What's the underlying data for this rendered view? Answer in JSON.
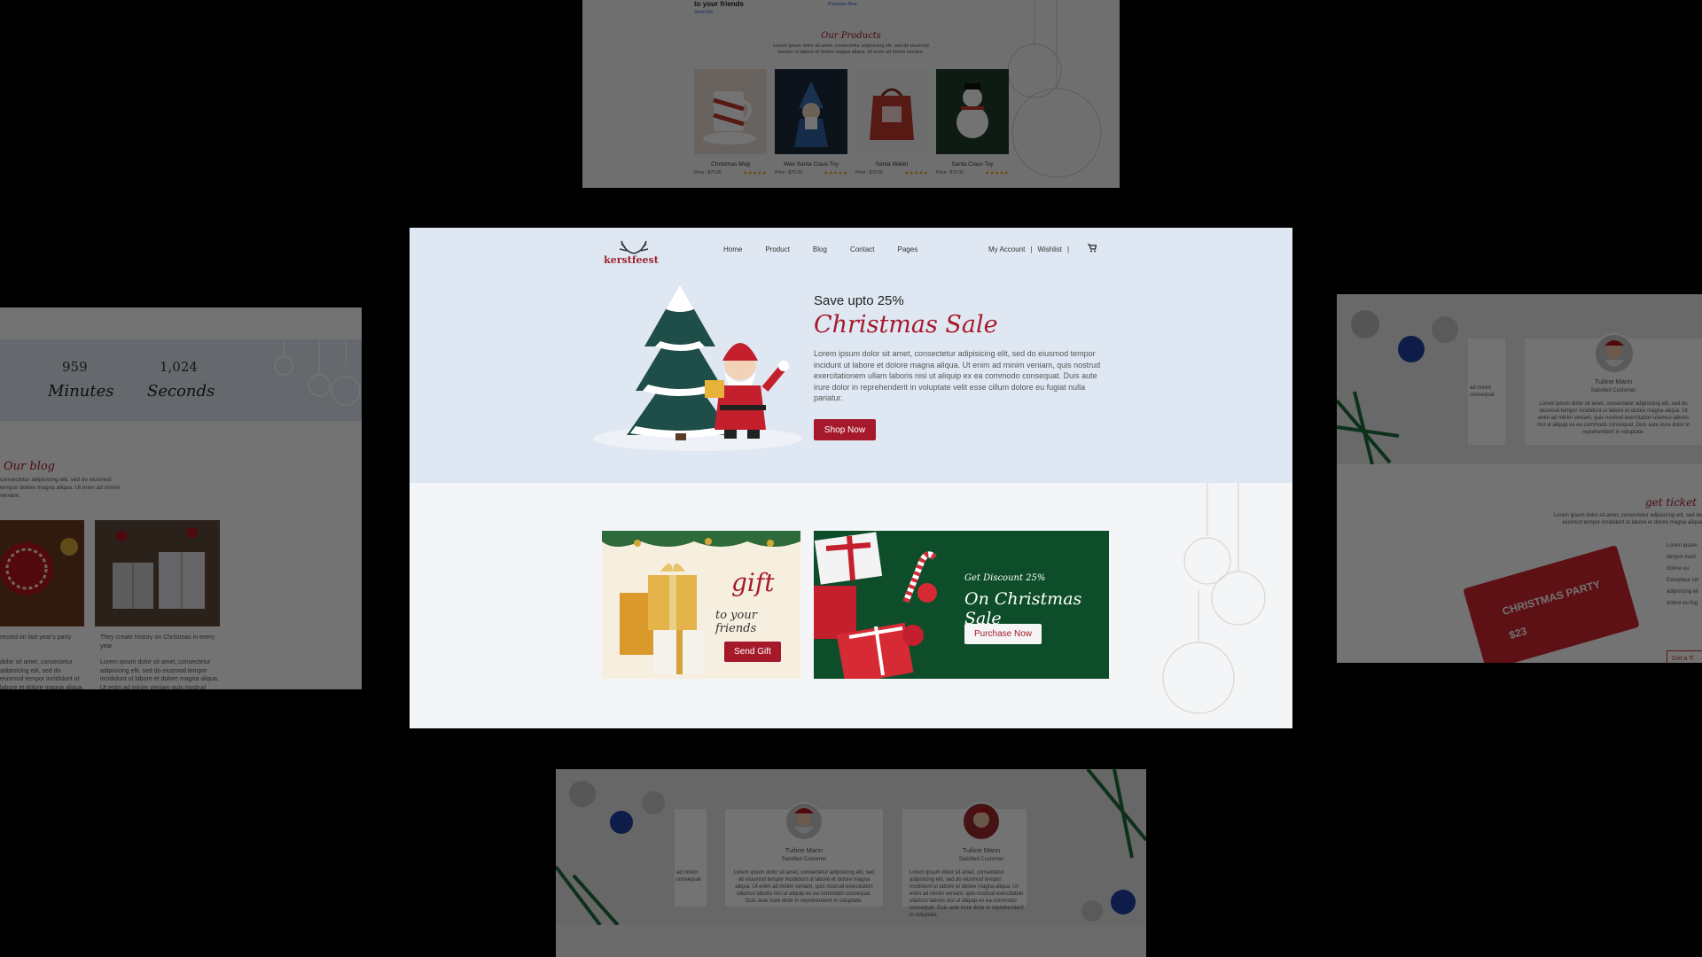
{
  "brand": {
    "name": "kerstfeest",
    "accent": "#a5192b"
  },
  "nav": {
    "links": [
      "Home",
      "Product",
      "Blog",
      "Contact",
      "Pages"
    ],
    "account": "My Account",
    "sep1": "|",
    "wishlist": "Wishlist",
    "sep2": "|",
    "cart_icon": "cart-icon"
  },
  "hero": {
    "kicker": "Save upto 25%",
    "title": "Christmas Sale",
    "body": "Lorem ipsum dolor sit amet, consectetur adipisicing elit, sed do eiusmod tempor incidunt ut labore et dolore magna aliqua. Ut enim ad minim veniam, quis nostrud exercitationem ullam laboris nisi ut aliquip ex ea commodo consequat. Duis aute irure dolor in reprehenderit in voluptate velit esse cillum dolore eu fugiat nulla pariatur.",
    "button": "Shop Now"
  },
  "promo_gift": {
    "title": "gift",
    "subtitle": "to your friends",
    "button": "Send Gift"
  },
  "promo_discount": {
    "kicker": "Get Discount 25%",
    "title": "On Christmas Sale",
    "button": "Purchase Now"
  },
  "top_preview": {
    "fragment": "to your friends",
    "send_gift": "Send Gift",
    "purchase": "Purchase Now",
    "section_title": "Our Products",
    "section_body": "Lorem ipsum dolor sit amet, consectetur adipisicing elit, sed do eiusmod tempor ut labore et dolore magna aliqua. Ut enim ad minim veniam.",
    "products": [
      {
        "name": "Christmas Mug",
        "price": "Price : $70.00",
        "stars": "★★★★★"
      },
      {
        "name": "Wax Santa Claus Toy",
        "price": "Price : $70.00",
        "stars": "★★★★★"
      },
      {
        "name": "Santa Wallet",
        "price": "Price : $70.00",
        "stars": "★★★★★"
      },
      {
        "name": "Santa Claus Toy",
        "price": "Price : $70.00",
        "stars": "★★★★★"
      }
    ]
  },
  "left_preview": {
    "minutes_value": "959",
    "minutes_label": "Minutes",
    "seconds_value": "1,024",
    "seconds_label": "Seconds",
    "blog_title": "Our blog",
    "blog_body": "consectetur adipisicing elit, sed do eiusmod tempor dolore magna aliqua. Ut enim ad minim veniam.",
    "post1_title": "record on last year's party",
    "post1_body": "dolor sit amet, consectetur adipisicing elit, sed do eiusmod tempor incididunt ut labore et dolore magna aliqua. Ut enim ad minim veniam quis nostrud ullamco laboris nisi",
    "post2_title": "They create history on Christmas in every year",
    "post2_body": "Lorem ipsum dolor sit amet, consectetur adipisicing elit, sed do eiusmod tempor incididunt ut labore et dolore magna aliqua. Ut enim ad minim veniam quis nostrud exercitation ullamco laboris nisi"
  },
  "right_preview": {
    "name": "Tuiline Marin",
    "role": "Satisfied Customer",
    "quote": "Lorem ipsum dolor sit amet, consectetur adipisicing elit, sed do eiusmod tempor incididunt ut labore et dolore magna aliqua. Ut enim ad minim veniam, quis nostrud exercitation ullamco laboris nisi ut aliquip ex ea commodo consequat. Duis aute irure dolor in reprehenderit in voluptate.",
    "side_fragment": "ad minim consequat",
    "ticket_title": "get ticket",
    "ticket_body": "Lorem ipsum dolor sit amet, consectetur adipisicing elit, sed do eiusmod tempor incididunt ut labore et dolore magna aliqua",
    "ticket_side": "Lorem ipsum tempor incid dolore eu Excepteur sin adipisicing eli dolore eu fug",
    "ticket_label": "CHRISTMAS PARTY",
    "ticket_price": "$23",
    "ticket_button": "Get a Ti"
  },
  "bottom_preview": {
    "t1_name": "Tuiline Marin",
    "t1_role": "Satisfied Customer",
    "t1_quote": "Lorem ipsum dolor sit amet, consectetur adipisicing elit, sed do eiusmod tempor incididunt ut labore et dolore magna aliqua. Ut enim ad minim veniam, quis nostrud exercitation ullamco laboris nisi ut aliquip ex ea commodo consequat. Duis aute irure dolor in reprehenderit in voluptate.",
    "t2_name": "Tuiline Marin",
    "t2_role": "Satisfied Customer",
    "t2_quote": "Lorem ipsum dolor sit amet, consectetur adipisicing elit, sed do eiusmod tempor incididunt ut labore et dolore magna aliqua. Ut enim ad minim veniam, quis nostrud exercitation ullamco laboris nisi ut aliquip ex ea commodo consequat. Duis aute irure dolor in reprehenderit in voluptate.",
    "side_fragment": "ad minim consequat"
  }
}
